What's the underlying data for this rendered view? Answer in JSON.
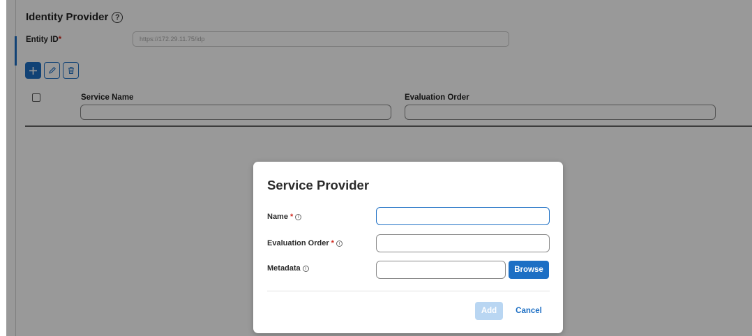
{
  "identity_provider": {
    "title": "Identity Provider",
    "help_icon": "help-circle-icon",
    "entity_id_label": "Entity ID",
    "required_mark": "*",
    "entity_id_value": "https://172.29.11.75/idp"
  },
  "toolbar": {
    "add_icon": "plus-icon",
    "edit_icon": "pencil-icon",
    "delete_icon": "trash-icon"
  },
  "table": {
    "columns": [
      "Service Name",
      "Evaluation Order"
    ]
  },
  "modal": {
    "title": "Service Provider",
    "fields": [
      {
        "label": "Name",
        "required": "*",
        "value": ""
      },
      {
        "label": "Evaluation Order",
        "required": "*",
        "value": ""
      },
      {
        "label": "Metadata",
        "value": ""
      }
    ],
    "browse_label": "Browse",
    "add_label": "Add",
    "cancel_label": "Cancel"
  },
  "colors": {
    "accent": "#1d6fc4",
    "required": "#d0271d",
    "add_disabled": "#b9d6f2"
  }
}
